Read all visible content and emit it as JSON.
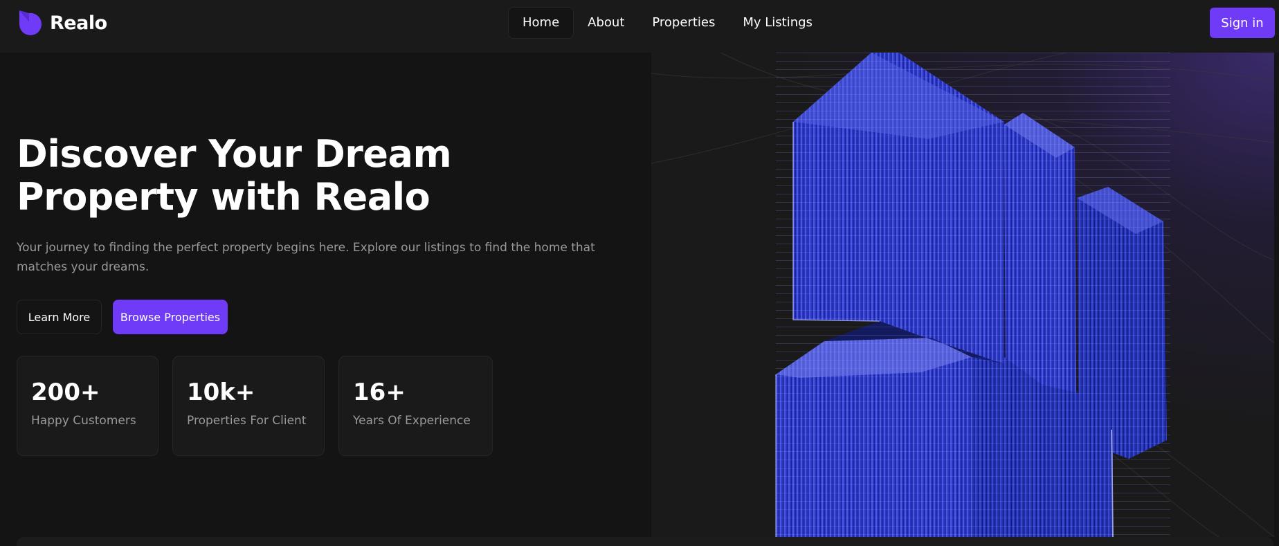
{
  "header": {
    "logo_text": "Realo",
    "logo_icon": "realo-logo-icon",
    "nav": [
      {
        "label": "Home",
        "active": true
      },
      {
        "label": "About",
        "active": false
      },
      {
        "label": "Properties",
        "active": false
      },
      {
        "label": "My Listings",
        "active": false
      }
    ],
    "signin_label": "Sign in"
  },
  "hero": {
    "title_line1": "Discover Your Dream",
    "title_line2": "Property with Realo",
    "subtitle": "Your journey to finding the perfect property begins here. Explore our listings to find the home that matches your dreams.",
    "learn_more_label": "Learn More",
    "browse_label": "Browse Properties",
    "stats": [
      {
        "value": "200+",
        "label": "Happy Customers"
      },
      {
        "value": "10k+",
        "label": "Properties For Client"
      },
      {
        "value": "16+",
        "label": "Years Of Experience"
      }
    ],
    "image_icon": "building-illustration"
  },
  "colors": {
    "accent": "#703bf7",
    "background": "#141414",
    "surface": "#1a1a1a",
    "border": "#262626",
    "muted_text": "#999999",
    "building": "#2b35c4"
  }
}
